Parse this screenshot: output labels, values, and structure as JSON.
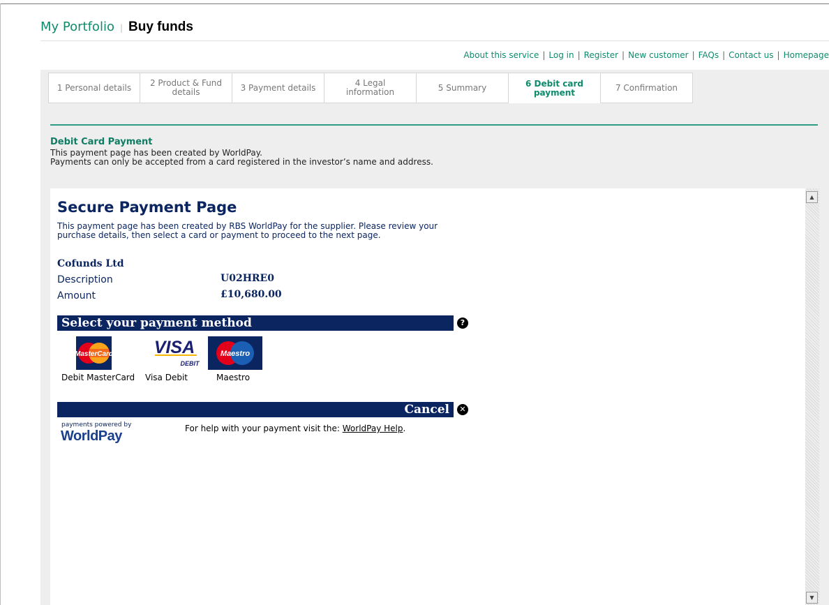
{
  "header": {
    "portfolio": "My Portfolio",
    "separator": "|",
    "title": "Buy funds"
  },
  "toplinks": [
    "About this service",
    "Log in",
    "Register",
    "New customer",
    "FAQs",
    "Contact us",
    "Homepage"
  ],
  "tabs": [
    {
      "label": "1 Personal details"
    },
    {
      "label": "2 Product & Fund details"
    },
    {
      "label": "3 Payment details"
    },
    {
      "label": "4 Legal information"
    },
    {
      "label": "5 Summary"
    },
    {
      "label": "6 Debit card payment",
      "active": true
    },
    {
      "label": "7 Confirmation"
    }
  ],
  "debit": {
    "title": "Debit Card Payment",
    "line1": "This payment page has been created by WorldPay.",
    "line2": "Payments can only be accepted from a card registered in the investor’s name and address."
  },
  "secure": {
    "title": "Secure Payment Page",
    "intro": "This payment page has been created by RBS WorldPay for the supplier. Please review your purchase details, then select a card or payment to proceed to the next page.",
    "supplier": "Cofunds Ltd",
    "description_label": "Description",
    "description_value": "U02HRE0",
    "amount_label": "Amount",
    "amount_value": "£10,680.00",
    "method_header": "Select your payment method",
    "cards": [
      {
        "label": "Debit MasterCard",
        "logo_text": "MasterCard"
      },
      {
        "label": "Visa Debit",
        "logo_text": "VISA",
        "sub_text": "DEBIT"
      },
      {
        "label": "Maestro",
        "logo_text": "Maestro"
      }
    ],
    "cancel": "Cancel",
    "powered_small": "payments powered by",
    "powered_brand": "WorldPay",
    "help_prefix": "For help with your payment visit the: ",
    "help_link": "WorldPay Help",
    "help_suffix": "."
  },
  "colors": {
    "brand_green": "#0f8b6c",
    "navy": "#0b2560",
    "panel_bg": "#eeeeee"
  },
  "icons": {
    "help": "question-circle-icon",
    "cancel": "close-circle-icon",
    "scroll_up": "arrow-up-icon",
    "scroll_down": "arrow-down-icon"
  }
}
